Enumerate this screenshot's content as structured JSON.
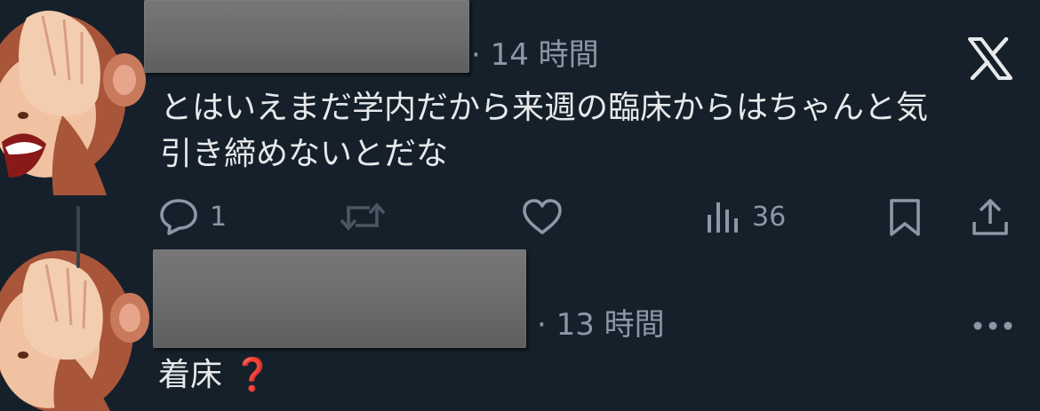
{
  "post1": {
    "timestamp": "· 14 時間",
    "text_line1": "とはいえまだ学内だから来週の臨床からはちゃんと気",
    "text_line2": "引き締めないとだな",
    "actions": {
      "reply_count": "1",
      "views_count": "36"
    }
  },
  "post2": {
    "timestamp": "· 13 時間",
    "text": "着床",
    "emoji": "❓"
  },
  "icons": {
    "reply": "comment-icon",
    "repost": "repost-icon",
    "like": "heart-icon",
    "views": "analytics-icon",
    "bookmark": "bookmark-icon",
    "share": "share-icon",
    "brand": "x-logo-icon",
    "more": "more-dots-icon"
  },
  "colors": {
    "background": "#15202b",
    "text": "#e7e9ea",
    "secondary": "#8b98a5",
    "emoji_red": "#d7263d"
  }
}
